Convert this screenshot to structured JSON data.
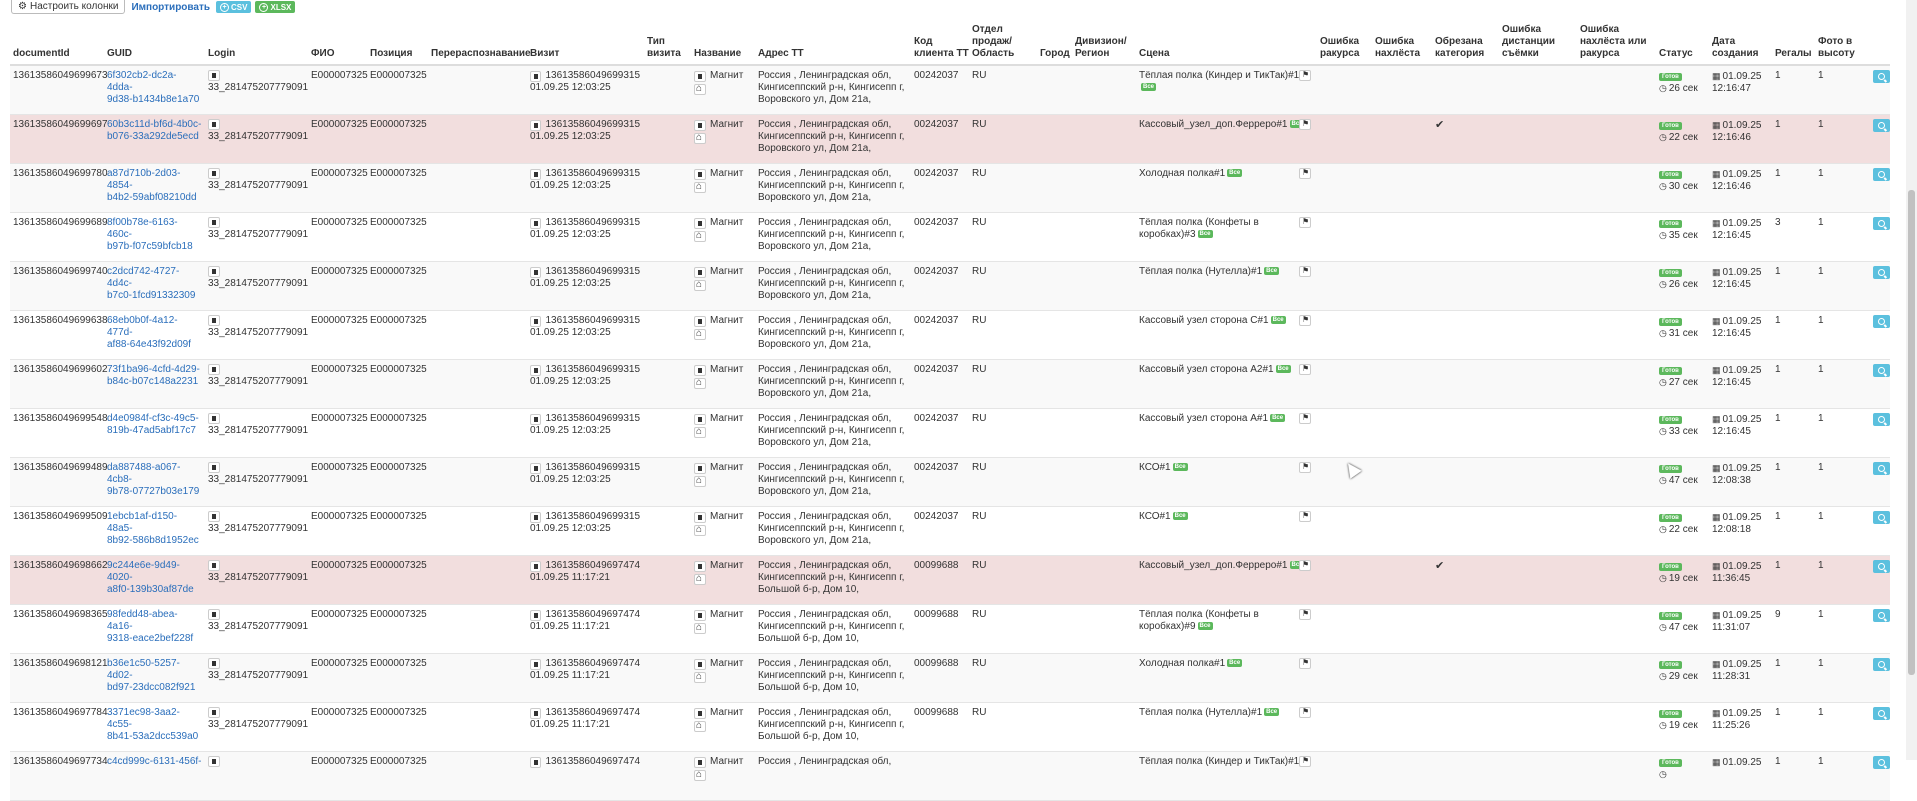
{
  "toolbar": {
    "settings_label": "Настроить колонки",
    "import_label": "Импортировать",
    "csv_label": "CSV",
    "xlsx_label": "XLSX"
  },
  "columns": [
    "documentId",
    "GUID",
    "Login",
    "ФИО",
    "Позиция",
    "Перераспознавание",
    "Визит",
    "Тип визита",
    "Название",
    "Адрес ТТ",
    "Код клиента ТТ",
    "Отдел продаж/ Область",
    "Город",
    "Дивизион/ Регион",
    "Сцена",
    "Ошибка ракурса",
    "Ошибка нахлёста",
    "Обрезана категория",
    "Ошибка дистанции съёмки",
    "Ошибка нахлёста или ракурса",
    "Статус",
    "Дата создания",
    "Регалы",
    "Фото в высоту"
  ],
  "rows": [
    {
      "docid": "13613586049699673",
      "guid1": "6f302cb2-dc2a-4dda-",
      "guid2": "9d38-b1434b8e1a70",
      "login": "33_281475207779091",
      "fio": "E000007325",
      "pos": "E000007325",
      "visit_id": "13613586049699315",
      "visit_dt": "01.09.25 12:03:25",
      "name": "Магнит",
      "addr1": "Россия , Ленинградская обл,",
      "addr2": "Кингисеппский р-н, Кингисепп г,",
      "addr3": "Воровского ул, Дом 21а,",
      "client": "00242037",
      "region": "RU",
      "scene": "Тёплая полка (Киндер и ТикТак)#1",
      "scene_tag": "Все",
      "crop": "",
      "status": "Готов",
      "status_time": "26 сек",
      "date1": "01.09.25",
      "date2": "12:16:47",
      "regals": "1",
      "photos": "1",
      "row_style": "odd"
    },
    {
      "docid": "13613586049699697",
      "guid1": "60b3c11d-bf6d-4b0c-",
      "guid2": "b076-33a292de5ecd",
      "login": "33_281475207779091",
      "fio": "E000007325",
      "pos": "E000007325",
      "visit_id": "13613586049699315",
      "visit_dt": "01.09.25 12:03:25",
      "name": "Магнит",
      "addr1": "Россия , Ленинградская обл,",
      "addr2": "Кингисеппский р-н, Кингисепп г,",
      "addr3": "Воровского ул, Дом 21а,",
      "client": "00242037",
      "region": "RU",
      "scene": "Кассовый_узел_доп.Ферреро#1",
      "scene_tag": "Все",
      "crop": "✔",
      "status": "Готов",
      "status_time": "22 сек",
      "date1": "01.09.25",
      "date2": "12:16:46",
      "regals": "1",
      "photos": "1",
      "row_style": "warn"
    },
    {
      "docid": "13613586049699780",
      "guid1": "a87d710b-2d03-4854-",
      "guid2": "b4b2-59abf08210dd",
      "login": "33_281475207779091",
      "fio": "E000007325",
      "pos": "E000007325",
      "visit_id": "13613586049699315",
      "visit_dt": "01.09.25 12:03:25",
      "name": "Магнит",
      "addr1": "Россия , Ленинградская обл,",
      "addr2": "Кингисеппский р-н, Кингисепп г,",
      "addr3": "Воровского ул, Дом 21а,",
      "client": "00242037",
      "region": "RU",
      "scene": "Холодная полка#1",
      "scene_tag": "Все",
      "crop": "",
      "status": "Готов",
      "status_time": "30 сек",
      "date1": "01.09.25",
      "date2": "12:16:46",
      "regals": "1",
      "photos": "1",
      "row_style": "odd"
    },
    {
      "docid": "13613586049699689",
      "guid1": "8f00b78e-6163-460c-",
      "guid2": "b97b-f07c59bfcb18",
      "login": "33_281475207779091",
      "fio": "E000007325",
      "pos": "E000007325",
      "visit_id": "13613586049699315",
      "visit_dt": "01.09.25 12:03:25",
      "name": "Магнит",
      "addr1": "Россия , Ленинградская обл,",
      "addr2": "Кингисеппский р-н, Кингисепп г,",
      "addr3": "Воровского ул, Дом 21а,",
      "client": "00242037",
      "region": "RU",
      "scene": "Тёплая полка (Конфеты в коробках)#3",
      "scene_tag": "Все",
      "crop": "",
      "status": "Готов",
      "status_time": "35 сек",
      "date1": "01.09.25",
      "date2": "12:16:45",
      "regals": "3",
      "photos": "1",
      "row_style": "plain"
    },
    {
      "docid": "13613586049699740",
      "guid1": "c2dcd742-4727-4d4c-",
      "guid2": "b7c0-1fcd91332309",
      "login": "33_281475207779091",
      "fio": "E000007325",
      "pos": "E000007325",
      "visit_id": "13613586049699315",
      "visit_dt": "01.09.25 12:03:25",
      "name": "Магнит",
      "addr1": "Россия , Ленинградская обл,",
      "addr2": "Кингисеппский р-н, Кингисепп г,",
      "addr3": "Воровского ул, Дом 21а,",
      "client": "00242037",
      "region": "RU",
      "scene": "Тёплая полка (Нутелла)#1",
      "scene_tag": "Все",
      "crop": "",
      "status": "Готов",
      "status_time": "26 сек",
      "date1": "01.09.25",
      "date2": "12:16:45",
      "regals": "1",
      "photos": "1",
      "row_style": "odd"
    },
    {
      "docid": "13613586049699638",
      "guid1": "68eb0b0f-4a12-477d-",
      "guid2": "af88-64e43f92d09f",
      "login": "33_281475207779091",
      "fio": "E000007325",
      "pos": "E000007325",
      "visit_id": "13613586049699315",
      "visit_dt": "01.09.25 12:03:25",
      "name": "Магнит",
      "addr1": "Россия , Ленинградская обл,",
      "addr2": "Кингисеппский р-н, Кингисепп г,",
      "addr3": "Воровского ул, Дом 21а,",
      "client": "00242037",
      "region": "RU",
      "scene": "Кассовый узел сторона С#1",
      "scene_tag": "Все",
      "crop": "",
      "status": "Готов",
      "status_time": "31 сек",
      "date1": "01.09.25",
      "date2": "12:16:45",
      "regals": "1",
      "photos": "1",
      "row_style": "plain"
    },
    {
      "docid": "13613586049699602",
      "guid1": "73f1ba96-4cfd-4d29-",
      "guid2": "b84c-b07c148a2231",
      "login": "33_281475207779091",
      "fio": "E000007325",
      "pos": "E000007325",
      "visit_id": "13613586049699315",
      "visit_dt": "01.09.25 12:03:25",
      "name": "Магнит",
      "addr1": "Россия , Ленинградская обл,",
      "addr2": "Кингисеппский р-н, Кингисепп г,",
      "addr3": "Воровского ул, Дом 21а,",
      "client": "00242037",
      "region": "RU",
      "scene": "Кассовый узел сторона А2#1",
      "scene_tag": "Все",
      "crop": "",
      "status": "Готов",
      "status_time": "27 сек",
      "date1": "01.09.25",
      "date2": "12:16:45",
      "regals": "1",
      "photos": "1",
      "row_style": "odd"
    },
    {
      "docid": "13613586049699548",
      "guid1": "d4e0984f-cf3c-49c5-",
      "guid2": "819b-47ad5abf17c7",
      "login": "33_281475207779091",
      "fio": "E000007325",
      "pos": "E000007325",
      "visit_id": "13613586049699315",
      "visit_dt": "01.09.25 12:03:25",
      "name": "Магнит",
      "addr1": "Россия , Ленинградская обл,",
      "addr2": "Кингисеппский р-н, Кингисепп г,",
      "addr3": "Воровского ул, Дом 21а,",
      "client": "00242037",
      "region": "RU",
      "scene": "Кассовый узел сторона А#1",
      "scene_tag": "Все",
      "crop": "",
      "status": "Готов",
      "status_time": "33 сек",
      "date1": "01.09.25",
      "date2": "12:16:45",
      "regals": "1",
      "photos": "1",
      "row_style": "plain"
    },
    {
      "docid": "13613586049699489",
      "guid1": "da887488-a067-4cb8-",
      "guid2": "9b78-07727b03e179",
      "login": "33_281475207779091",
      "fio": "E000007325",
      "pos": "E000007325",
      "visit_id": "13613586049699315",
      "visit_dt": "01.09.25 12:03:25",
      "name": "Магнит",
      "addr1": "Россия , Ленинградская обл,",
      "addr2": "Кингисеппский р-н, Кингисепп г,",
      "addr3": "Воровского ул, Дом 21а,",
      "client": "00242037",
      "region": "RU",
      "scene": "КСО#1",
      "scene_tag": "Все",
      "crop": "",
      "status": "Готов",
      "status_time": "47 сек",
      "date1": "01.09.25",
      "date2": "12:08:38",
      "regals": "1",
      "photos": "1",
      "row_style": "odd"
    },
    {
      "docid": "13613586049699509",
      "guid1": "1ebcb1af-d150-48a5-",
      "guid2": "8b92-586b8d1952ec",
      "login": "33_281475207779091",
      "fio": "E000007325",
      "pos": "E000007325",
      "visit_id": "13613586049699315",
      "visit_dt": "01.09.25 12:03:25",
      "name": "Магнит",
      "addr1": "Россия , Ленинградская обл,",
      "addr2": "Кингисеппский р-н, Кингисепп г,",
      "addr3": "Воровского ул, Дом 21а,",
      "client": "00242037",
      "region": "RU",
      "scene": "КСО#1",
      "scene_tag": "Все",
      "crop": "",
      "status": "Готов",
      "status_time": "22 сек",
      "date1": "01.09.25",
      "date2": "12:08:18",
      "regals": "1",
      "photos": "1",
      "row_style": "plain"
    },
    {
      "docid": "13613586049698662",
      "guid1": "9c244e6e-9d49-4020-",
      "guid2": "a8f0-139b30af87de",
      "login": "33_281475207779091",
      "fio": "E000007325",
      "pos": "E000007325",
      "visit_id": "13613586049697474",
      "visit_dt": "01.09.25 11:17:21",
      "name": "Магнит",
      "addr1": "Россия , Ленинградская обл,",
      "addr2": "Кингисеппский р-н, Кингисепп г,",
      "addr3": "Большой б-р, Дом 10,",
      "client": "00099688",
      "region": "RU",
      "scene": "Кассовый_узел_доп.Ферреро#1",
      "scene_tag": "Все",
      "crop": "✔",
      "status": "Готов",
      "status_time": "19 сек",
      "date1": "01.09.25",
      "date2": "11:36:45",
      "regals": "1",
      "photos": "1",
      "row_style": "warn"
    },
    {
      "docid": "13613586049698365",
      "guid1": "98fedd48-abea-4a16-",
      "guid2": "9318-eace2bef228f",
      "login": "33_281475207779091",
      "fio": "E000007325",
      "pos": "E000007325",
      "visit_id": "13613586049697474",
      "visit_dt": "01.09.25 11:17:21",
      "name": "Магнит",
      "addr1": "Россия , Ленинградская обл,",
      "addr2": "Кингисеппский р-н, Кингисепп г,",
      "addr3": "Большой б-р, Дом 10,",
      "client": "00099688",
      "region": "RU",
      "scene": "Тёплая полка (Конфеты в коробках)#9",
      "scene_tag": "Все",
      "crop": "",
      "status": "Готов",
      "status_time": "47 сек",
      "date1": "01.09.25",
      "date2": "11:31:07",
      "regals": "9",
      "photos": "1",
      "row_style": "plain"
    },
    {
      "docid": "13613586049698121",
      "guid1": "b36e1c50-5257-4d02-",
      "guid2": "bd97-23dcc082f921",
      "login": "33_281475207779091",
      "fio": "E000007325",
      "pos": "E000007325",
      "visit_id": "13613586049697474",
      "visit_dt": "01.09.25 11:17:21",
      "name": "Магнит",
      "addr1": "Россия , Ленинградская обл,",
      "addr2": "Кингисеппский р-н, Кингисепп г,",
      "addr3": "Большой б-р, Дом 10,",
      "client": "00099688",
      "region": "RU",
      "scene": "Холодная полка#1",
      "scene_tag": "Все",
      "crop": "",
      "status": "Готов",
      "status_time": "29 сек",
      "date1": "01.09.25",
      "date2": "11:28:31",
      "regals": "1",
      "photos": "1",
      "row_style": "odd"
    },
    {
      "docid": "13613586049697784",
      "guid1": "3371ec98-3aa2-4c55-",
      "guid2": "8b41-53a2dcc539a0",
      "login": "33_281475207779091",
      "fio": "E000007325",
      "pos": "E000007325",
      "visit_id": "13613586049697474",
      "visit_dt": "01.09.25 11:17:21",
      "name": "Магнит",
      "addr1": "Россия , Ленинградская обл,",
      "addr2": "Кингисеппский р-н, Кингисепп г,",
      "addr3": "Большой б-р, Дом 10,",
      "client": "00099688",
      "region": "RU",
      "scene": "Тёплая полка (Нутелла)#1",
      "scene_tag": "Все",
      "crop": "",
      "status": "Готов",
      "status_time": "19 сек",
      "date1": "01.09.25",
      "date2": "11:25:26",
      "regals": "1",
      "photos": "1",
      "row_style": "plain"
    },
    {
      "docid": "13613586049697734",
      "guid1": "c4cd999c-6131-456f-",
      "guid2": "",
      "login": "",
      "fio": "E000007325",
      "pos": "E000007325",
      "visit_id": "13613586049697474",
      "visit_dt": "",
      "name": "Магнит",
      "addr1": "Россия , Ленинградская обл,",
      "addr2": "",
      "addr3": "",
      "client": "",
      "region": "",
      "scene": "Тёплая полка (Киндер и ТикТак)#1",
      "scene_tag": "",
      "crop": "",
      "status": "Готов",
      "status_time": "",
      "date1": "01.09.25",
      "date2": "",
      "regals": "1",
      "photos": "1",
      "row_style": "odd"
    }
  ]
}
